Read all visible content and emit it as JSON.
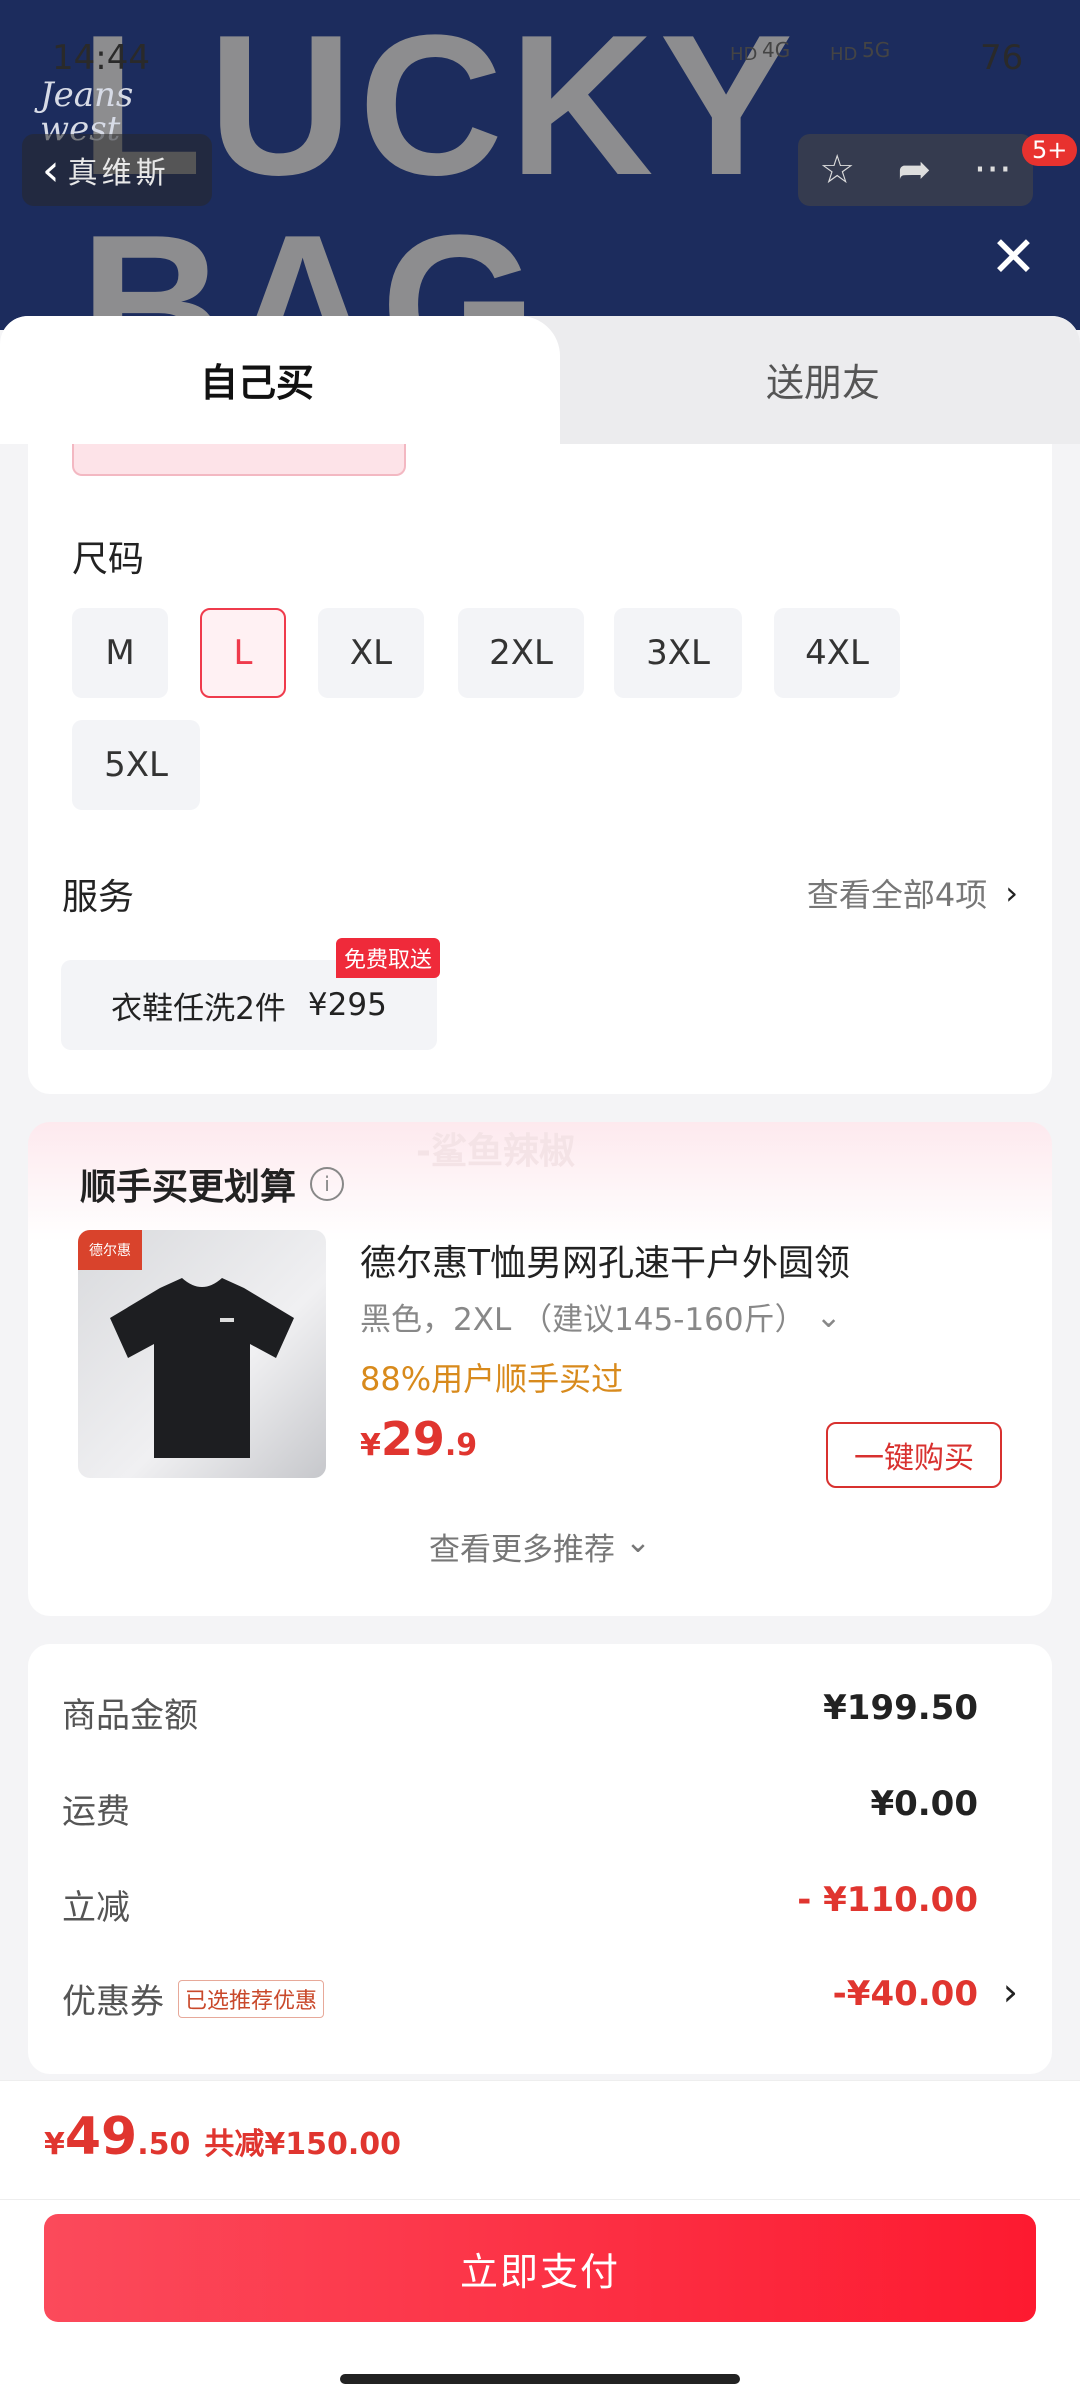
{
  "status_bar": {
    "time": "14:44",
    "battery": "76",
    "network_a": "4G",
    "network_b": "5G",
    "network_a_tag": "HD",
    "network_b_tag": "HD"
  },
  "header": {
    "banner_text": "LUCKY BAG",
    "logo_line1": "Jeans",
    "logo_line2": "west",
    "back_brand": "真维斯",
    "badge": "5+"
  },
  "tabs": [
    {
      "label": "自己买",
      "selected": true
    },
    {
      "label": "送朋友",
      "selected": false
    }
  ],
  "size_section": {
    "title": "尺码",
    "options": [
      "M",
      "L",
      "XL",
      "2XL",
      "3XL",
      "4XL",
      "5XL"
    ],
    "selected": "L"
  },
  "service_section": {
    "title": "服务",
    "view_all": "查看全部4项",
    "item_label": "衣鞋任洗2件",
    "item_price": "¥295",
    "item_tag": "免费取送"
  },
  "recommend": {
    "title": "顺手买更划算",
    "watermark": "-鲨鱼辣椒",
    "product": {
      "name": "德尔惠T恤男网孔速干户外圆领",
      "variant": "黑色，2XL （建议145-160斤）",
      "social_proof": "88%用户顺手买过",
      "price_currency": "¥",
      "price_int": "29",
      "price_dec": ".9",
      "buy_label": "一键购买",
      "image_logo": "德尔惠"
    },
    "more_label": "查看更多推荐"
  },
  "price_summary": {
    "rows": [
      {
        "label": "商品金额",
        "value": "¥199.50"
      },
      {
        "label": "运费",
        "value": "¥0.00"
      },
      {
        "label": "立减",
        "value": "- ¥110.00"
      },
      {
        "label": "优惠券",
        "value": "-¥40.00",
        "tag": "已选推荐优惠"
      }
    ]
  },
  "checkout": {
    "currency": "¥",
    "total_int": "49",
    "total_dec": ".50",
    "discount_text": "共减¥150.00",
    "pay_label": "立即支付"
  },
  "colors": {
    "accent": "#ef3b4c",
    "price_red": "#e0352f",
    "banner_bg": "#1c2c5d",
    "orange": "#d88a1c"
  }
}
